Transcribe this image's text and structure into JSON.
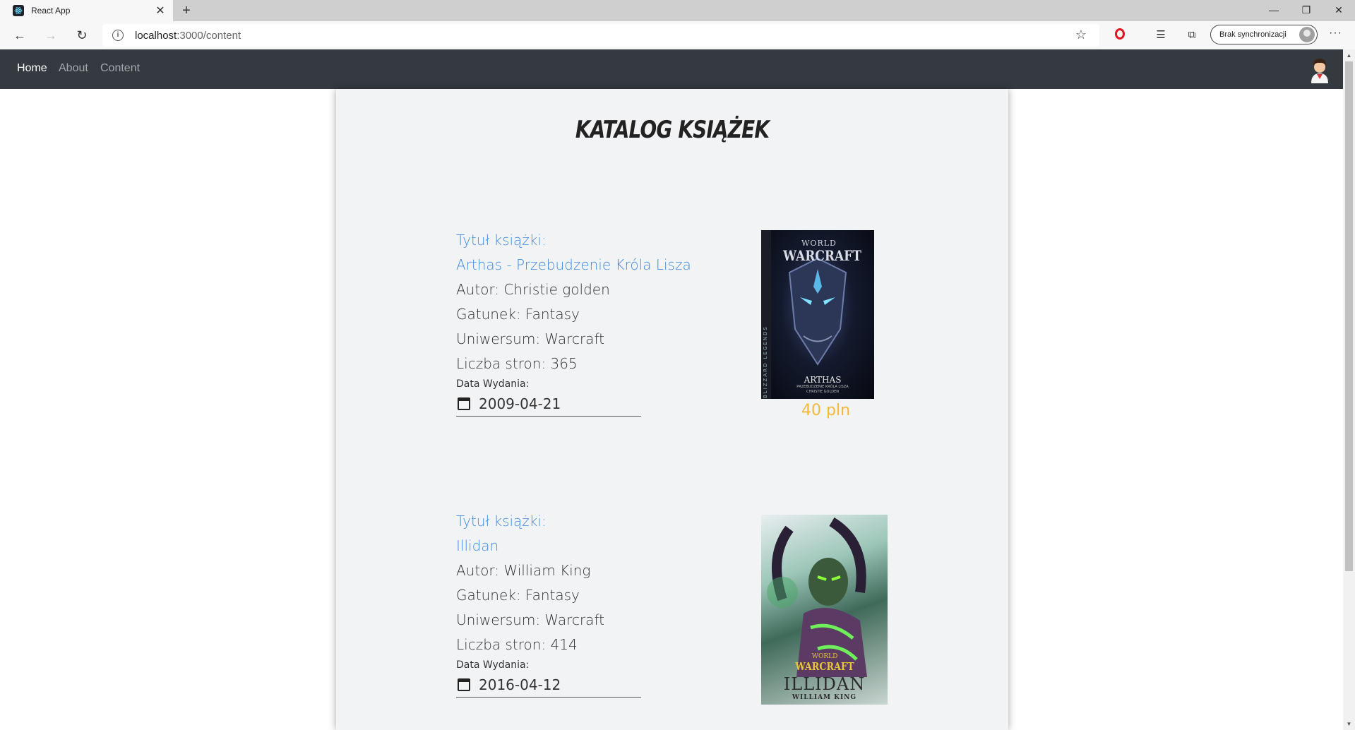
{
  "browser": {
    "tab_title": "React App",
    "url_host": "localhost",
    "url_rest": ":3000/content",
    "sync_label": "Brak synchronizacji"
  },
  "navbar": {
    "links": [
      "Home",
      "About",
      "Content"
    ]
  },
  "page": {
    "title": "Katalog Książek"
  },
  "books": [
    {
      "title_label": "Tytuł książki:",
      "title": "Arthas - Przebudzenie Króla Lisza",
      "author": "Autor: Christie golden",
      "genre": "Gatunek: Fantasy",
      "universe": "Uniwersum: Warcraft",
      "pages": "Liczba stron: 365",
      "date_label": "Data Wydania:",
      "date": "2009-04-21",
      "price": "40 pln",
      "cover_text_top": "WORLD",
      "cover_text_logo": "WARCRAFT",
      "cover_text_name": "ARTHAS",
      "cover_text_sub": "PRZEBUDZENIE KRÓLA LISZA",
      "cover_text_author": "CHRISTIE GOLDEN",
      "cover_text_side": "BLIZZARD LEGENDS"
    },
    {
      "title_label": "Tytuł książki:",
      "title": "Illidan",
      "author": "Autor: William King",
      "genre": "Gatunek: Fantasy",
      "universe": "Uniwersum: Warcraft",
      "pages": "Liczba stron: 414",
      "date_label": "Data Wydania:",
      "date": "2016-04-12",
      "cover_text_top": "WORLD",
      "cover_text_logo": "WARCRAFT",
      "cover_text_name": "ILLIDAN",
      "cover_text_author": "WILLIAM KING"
    }
  ]
}
